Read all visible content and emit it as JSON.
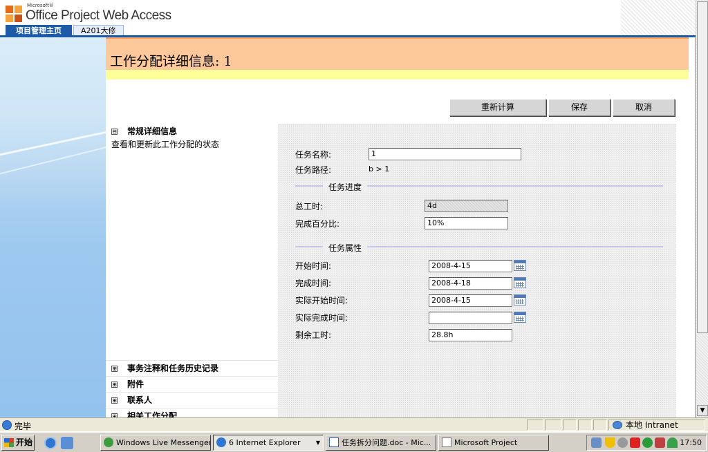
{
  "header": {
    "logo_small": "Microsoft®",
    "logo_main": "Office Project Web Access",
    "tabs": [
      {
        "label": "项目管理主页",
        "active": true
      },
      {
        "label": "A201大修",
        "active": false
      }
    ]
  },
  "page": {
    "title": "工作分配详细信息: 1",
    "buttons": {
      "recalc": "重新计算",
      "save": "保存",
      "cancel": "取消"
    },
    "sections": {
      "general": {
        "title": "常规详细信息",
        "description": "查看和更新此工作分配的状态",
        "expander": "⊟"
      },
      "notes": {
        "title": "事务注释和任务历史记录",
        "expander": "⊞"
      },
      "attachments": {
        "title": "附件",
        "expander": "⊞"
      },
      "contacts": {
        "title": "联系人",
        "expander": "⊞"
      },
      "related": {
        "title": "相关工作分配",
        "expander": "⊞"
      }
    },
    "form": {
      "task_name_label": "任务名称:",
      "task_name_value": "1",
      "task_path_label": "任务路径:",
      "task_path_value": "b > 1",
      "progress_group": "任务进度",
      "total_work_label": "总工时:",
      "total_work_value": "4d",
      "percent_label": "完成百分比:",
      "percent_value": "10%",
      "props_group": "任务属性",
      "start_label": "开始时间:",
      "start_value": "2008-4-15",
      "finish_label": "完成时间:",
      "finish_value": "2008-4-18",
      "actual_start_label": "实际开始时间:",
      "actual_start_value": "2008-4-15",
      "actual_finish_label": "实际完成时间:",
      "actual_finish_value": "",
      "remaining_label": "剩余工时:",
      "remaining_value": "28.8h"
    }
  },
  "statusbar": {
    "status": "完毕",
    "zone": "本地 Intranet"
  },
  "taskbar": {
    "start": "开始",
    "items": [
      {
        "label": "Windows Live Messenger",
        "active": false
      },
      {
        "label": "6 Internet Explorer",
        "active": true
      },
      {
        "label": "任务拆分问题.doc - Mic...",
        "active": false
      },
      {
        "label": "Microsoft Project",
        "active": false
      }
    ],
    "clock": "17:50"
  }
}
